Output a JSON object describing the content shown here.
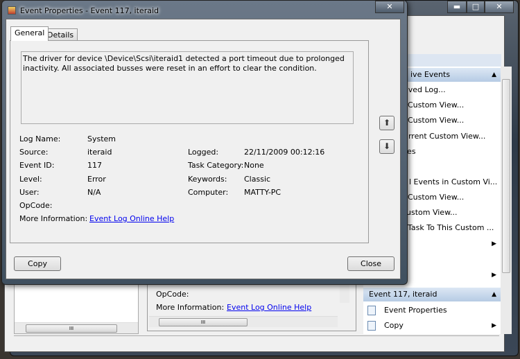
{
  "background_window": {
    "actions_pane": {
      "section1_header": "ive Events",
      "items": [
        "aved Log...",
        "Custom View...",
        "Custom View...",
        "urrent Custom View...",
        "ies",
        "",
        "l Events in Custom Vi...",
        "Custom View...",
        "ustom View...",
        "Task To This Custom ...",
        "",
        "",
        "",
        ""
      ],
      "section2_header": "Event 117, iteraid",
      "section2_items": [
        {
          "label": "Event Properties",
          "icon": "properties-icon"
        },
        {
          "label": "Copy",
          "icon": "copy-icon"
        }
      ]
    },
    "details_pane": {
      "opcode_label": "OpCode:",
      "more_info_label": "More Information:",
      "more_info_link": "Event Log Online Help"
    }
  },
  "dialog": {
    "title": "Event Properties - Event 117, iteraid",
    "tabs": [
      "General",
      "Details"
    ],
    "active_tab": "General",
    "description": "The driver for device \\Device\\Scsi\\iteraid1 detected a port timeout due to prolonged inactivity. All associated busses were reset in an effort to clear the condition.",
    "fields": {
      "log_name": {
        "label": "Log Name:",
        "value": "System"
      },
      "source": {
        "label": "Source:",
        "value": "iteraid"
      },
      "logged": {
        "label": "Logged:",
        "value": "22/11/2009 00:12:16"
      },
      "event_id": {
        "label": "Event ID:",
        "value": "117"
      },
      "task_category": {
        "label": "Task Category:",
        "value": "None"
      },
      "level": {
        "label": "Level:",
        "value": "Error"
      },
      "keywords": {
        "label": "Keywords:",
        "value": "Classic"
      },
      "user": {
        "label": "User:",
        "value": "N/A"
      },
      "computer": {
        "label": "Computer:",
        "value": "MATTY-PC"
      },
      "opcode": {
        "label": "OpCode:",
        "value": ""
      },
      "more_info": {
        "label": "More Information:",
        "link": "Event Log Online Help"
      }
    },
    "copy_label": "Copy",
    "close_label": "Close"
  }
}
